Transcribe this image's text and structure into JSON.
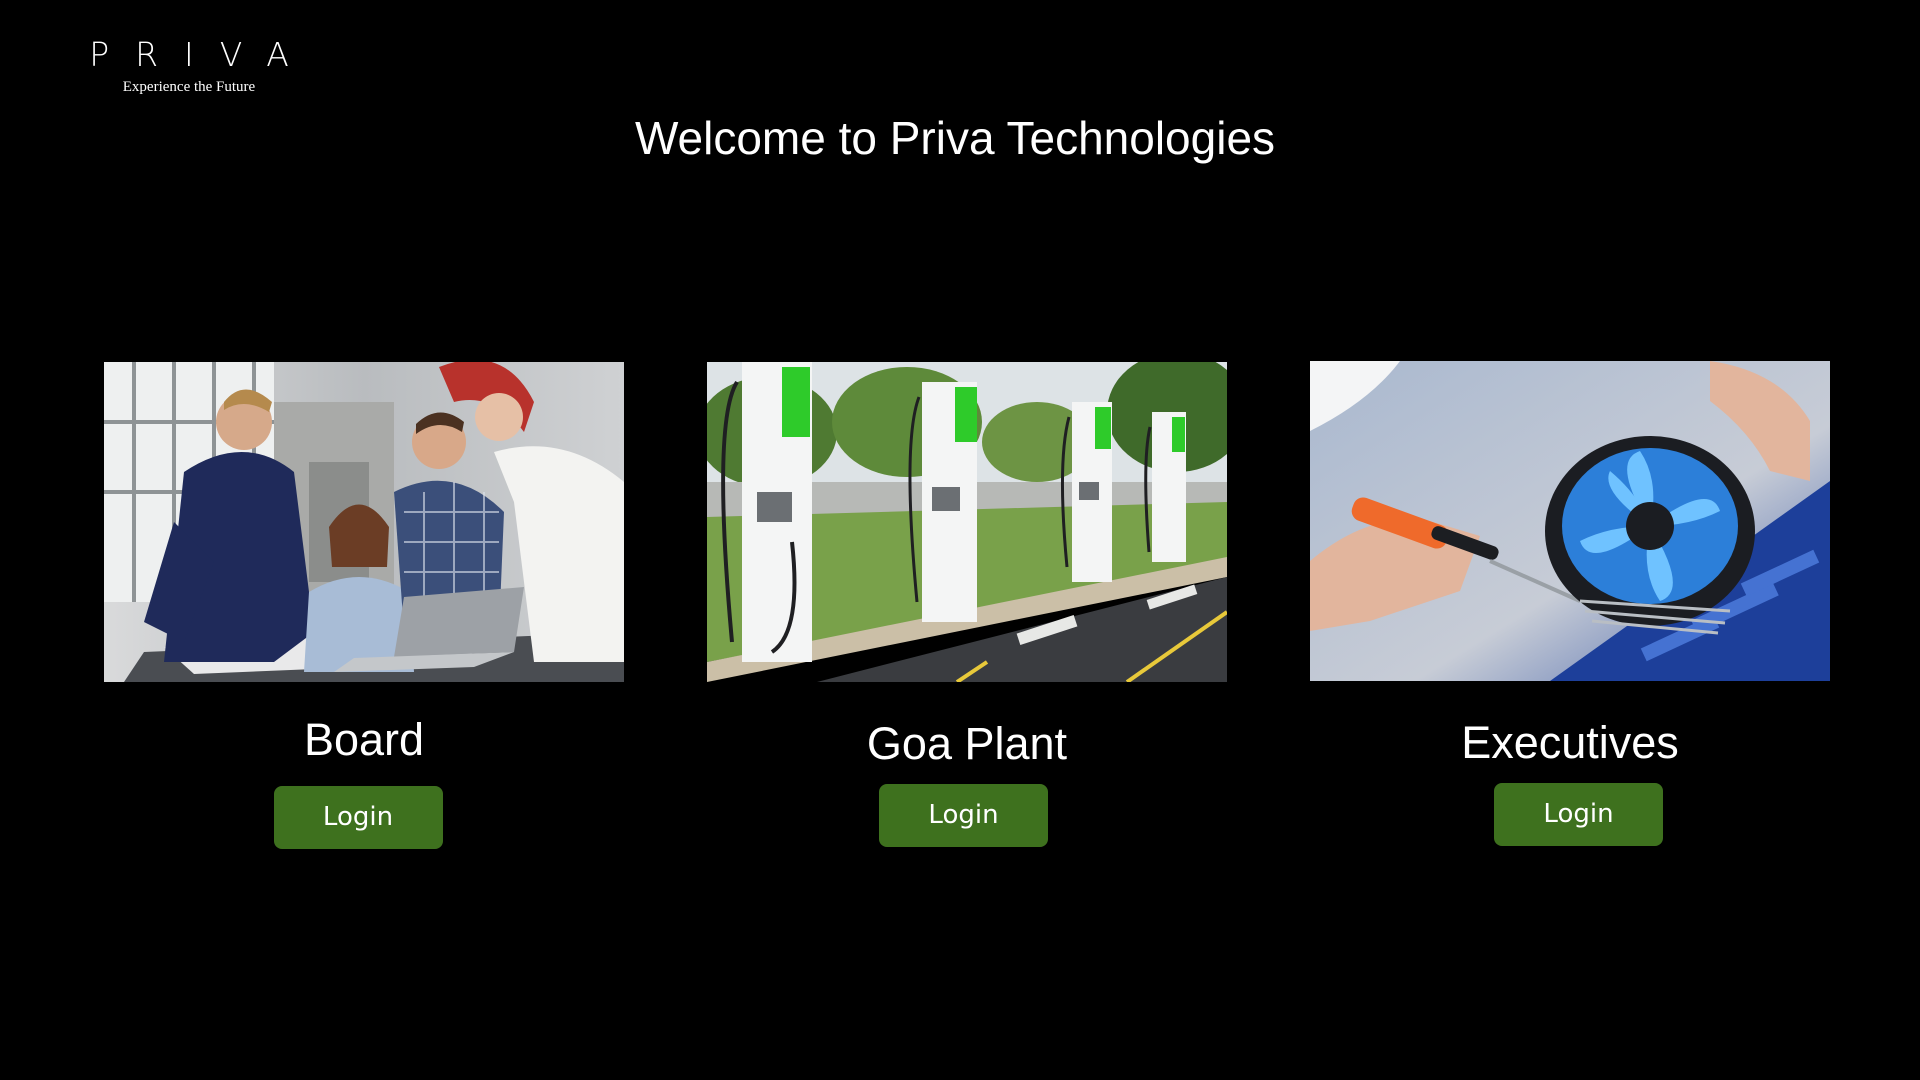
{
  "logo": {
    "wordmark": "PRIVA",
    "tagline": "Experience the Future"
  },
  "header": {
    "title": "Welcome to Priva Technologies"
  },
  "cards": [
    {
      "label": "Board",
      "button_label": "Login",
      "image": "team-meeting-photo"
    },
    {
      "label": "Goa Plant",
      "button_label": "Login",
      "image": "ev-charging-stations-photo"
    },
    {
      "label": "Executives",
      "button_label": "Login",
      "image": "cpu-cooler-fan-photo"
    }
  ],
  "colors": {
    "background": "#000000",
    "button": "#3e711e",
    "text": "#ffffff"
  }
}
